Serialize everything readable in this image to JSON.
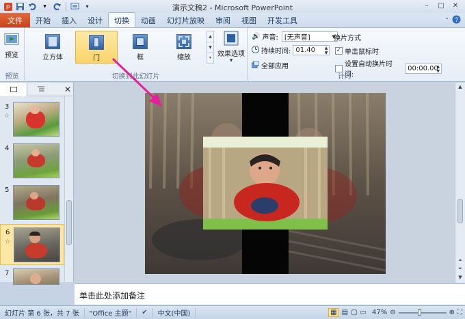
{
  "window": {
    "title": "演示文稿2 - Microsoft PowerPoint",
    "controls": {
      "minimize": "–",
      "maximize": "□",
      "close": "✕"
    }
  },
  "qat": {
    "icons": [
      "save-icon",
      "undo-icon",
      "redo-icon",
      "slideshow-icon"
    ]
  },
  "tabs": {
    "file": "文件",
    "items": [
      "开始",
      "插入",
      "设计",
      "切换",
      "动画",
      "幻灯片放映",
      "审阅",
      "视图",
      "开发工具"
    ],
    "active": "切换"
  },
  "ribbon": {
    "preview": {
      "label": "预览",
      "group": "预览"
    },
    "transitions": {
      "group": "切换到此幻灯片",
      "items": [
        "立方体",
        "门",
        "框",
        "缩放"
      ],
      "selected": "门"
    },
    "effect_options": {
      "label": "效果选项"
    },
    "timing": {
      "group": "计时",
      "sound_label": "声音:",
      "sound_value": "[无声音]",
      "duration_label": "持续时间:",
      "duration_value": "01.40",
      "apply_all": "全部应用",
      "advance_title": "换片方式",
      "on_click": "单击鼠标时",
      "on_click_checked": true,
      "auto_after": "设置自动换片时间:",
      "auto_after_checked": false,
      "auto_after_value": "00:00.00"
    }
  },
  "slides_panel": {
    "slides": [
      {
        "num": "3",
        "star": "☆"
      },
      {
        "num": "4",
        "star": ""
      },
      {
        "num": "5",
        "star": ""
      },
      {
        "num": "6",
        "star": "☆"
      },
      {
        "num": "7",
        "star": ""
      }
    ],
    "current": "6"
  },
  "notes": {
    "placeholder": "单击此处添加备注"
  },
  "status": {
    "slide_info": "幻灯片 第 6 张，共 7 张",
    "theme": "\"Office 主题\"",
    "language": "中文(中国)",
    "zoom": "47%"
  },
  "colors": {
    "accent": "#c8421d",
    "selection": "#f9d46a",
    "arrow": "#e61f9e"
  }
}
